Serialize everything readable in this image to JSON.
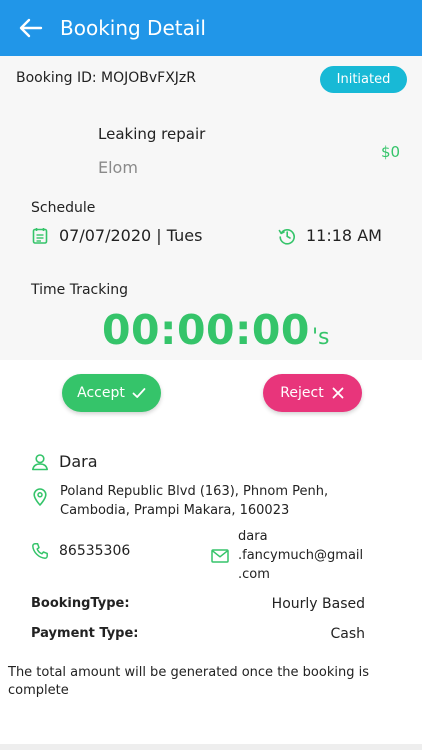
{
  "header": {
    "title": "Booking Detail"
  },
  "booking": {
    "id_text": "Booking ID: MOJOBvFXJzR",
    "status": "Initiated",
    "service_title": "Leaking repair",
    "service_subtitle": "Elom",
    "price": "$0"
  },
  "schedule": {
    "label": "Schedule",
    "date": "07/07/2020 | Tues",
    "time": "11:18 AM"
  },
  "tracking": {
    "label": "Time Tracking",
    "timer": "00:00:00",
    "unit": "'s"
  },
  "actions": {
    "accept_label": "Accept",
    "reject_label": "Reject"
  },
  "customer": {
    "name": "Dara",
    "address": "Poland Republic Blvd (163), Phnom Penh, Cambodia, Prampi Makara, 160023",
    "phone": "86535306",
    "email": "dara\n.fancymuch@gmail\n.com"
  },
  "details": {
    "booking_type_label": "BookingType:",
    "booking_type_value": "Hourly Based",
    "payment_type_label": "Payment Type:",
    "payment_type_value": "Cash"
  },
  "note": "The total amount will be generated once the booking is complete",
  "colors": {
    "header": "#2196e8",
    "status_badge": "#18b9d6",
    "green": "#35c46a",
    "pink": "#e8357b"
  },
  "icons": {
    "back": "arrow-left-icon",
    "calendar": "calendar-icon",
    "clock": "clock-history-icon",
    "user": "user-icon",
    "location": "location-pin-icon",
    "phone": "phone-icon",
    "email": "envelope-icon",
    "check": "check-icon",
    "close": "close-icon"
  }
}
